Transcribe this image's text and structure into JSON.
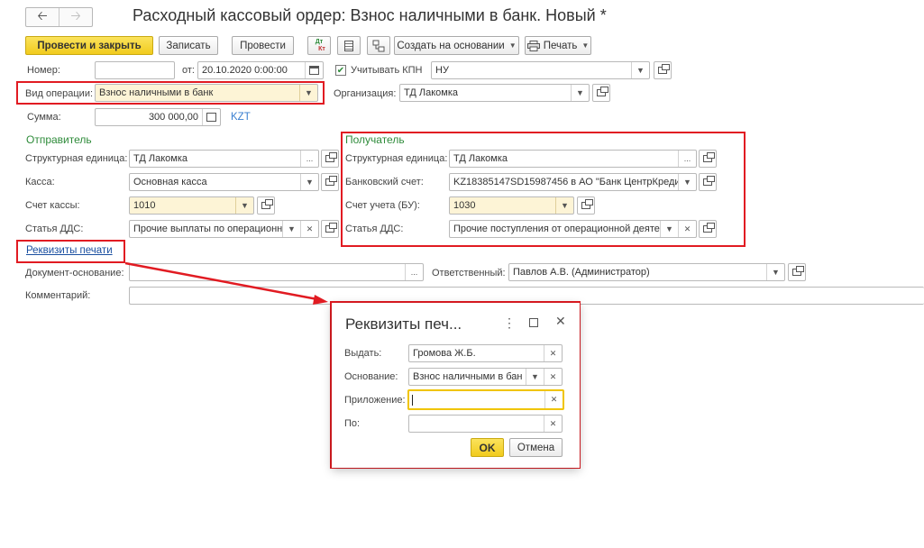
{
  "header": {
    "title": "Расходный кассовый ордер: Взнос наличными в банк. Новый *",
    "back_icon": "arrow-left-icon",
    "forward_icon": "arrow-right-icon"
  },
  "toolbar": {
    "post_close_label": "Провести и закрыть",
    "save_label": "Записать",
    "post_label": "Провести",
    "dt_kt_top": "Дт",
    "dt_kt_bottom": "Кт",
    "create_based_label": "Создать на основании",
    "print_label": "Печать"
  },
  "form": {
    "number_label": "Номер:",
    "number_value": "",
    "date_label": "от:",
    "date_value": "20.10.2020  0:00:00",
    "kpn_label": "Учитывать КПН",
    "kpn_checked": true,
    "tax_value": "НУ",
    "operation_label": "Вид операции:",
    "operation_value": "Взнос наличными в банк",
    "organization_label": "Организация:",
    "organization_value": "ТД Лакомка",
    "amount_label": "Сумма:",
    "amount_value": "300 000,00",
    "currency": "KZT"
  },
  "sender": {
    "heading": "Отправитель",
    "unit_label": "Структурная единица:",
    "unit_value": "ТД Лакомка",
    "cash_label": "Касса:",
    "cash_value": "Основная касса",
    "account_label": "Счет кассы:",
    "account_value": "1010",
    "dds_label": "Статья ДДС:",
    "dds_value": "Прочие выплаты по операционн"
  },
  "receiver": {
    "heading": "Получатель",
    "unit_label": "Структурная единица:",
    "unit_value": "ТД Лакомка",
    "bank_label": "Банковский счет:",
    "bank_value": "KZ18385147SD15987456 в АО \"Банк ЦентрКреди",
    "account_label": "Счет учета (БУ):",
    "account_value": "1030",
    "dds_label": "Статья ДДС:",
    "dds_value": "Прочие поступления от операционной деяте"
  },
  "bottom": {
    "print_details_link": "Реквизиты печати",
    "basis_doc_label": "Документ-основание:",
    "basis_doc_value": "",
    "responsible_label": "Ответственный:",
    "responsible_value": "Павлов А.В. (Администратор)",
    "comment_label": "Комментарий:",
    "comment_value": ""
  },
  "dialog": {
    "title": "Реквизиты печ...",
    "issue_label": "Выдать:",
    "issue_value": "Громова Ж.Б.",
    "basis_label": "Основание:",
    "basis_value": "Взнос наличными в бан",
    "attachment_label": "Приложение:",
    "attachment_value": "",
    "to_label": "По:",
    "to_value": "",
    "ok_label": "OK",
    "cancel_label": "Отмена"
  },
  "colors": {
    "accent_yellow": "#f5d327",
    "highlight_red": "#e11b22",
    "heading_green": "#2e8b3a",
    "link_blue": "#1a4fa0",
    "currency_blue": "#3a7fd0"
  }
}
